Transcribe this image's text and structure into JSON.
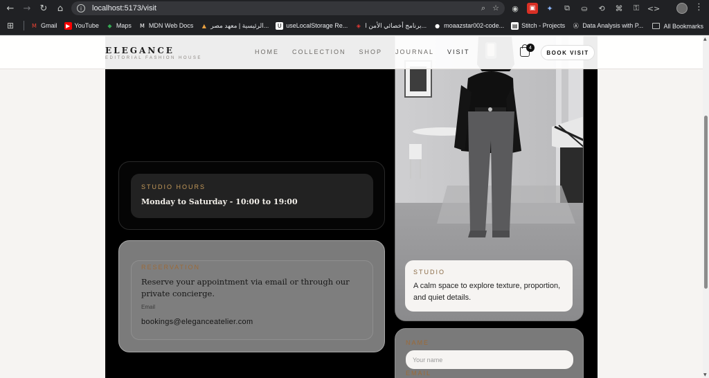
{
  "browser": {
    "url": "localhost:5173/visit",
    "bookmarks": [
      {
        "label": "Gmail",
        "icon": "gmail-icon"
      },
      {
        "label": "YouTube",
        "icon": "youtube-icon"
      },
      {
        "label": "Maps",
        "icon": "maps-icon"
      },
      {
        "label": "MDN Web Docs",
        "icon": "mdn-icon"
      },
      {
        "label": "الرئيسية | معهد مصر...",
        "icon": "institute-icon"
      },
      {
        "label": "useLocalStorage Re...",
        "icon": "use-icon"
      },
      {
        "label": "برنامج أخصائي الأمن ا...",
        "icon": "shield-icon"
      },
      {
        "label": "moaazstar002-code...",
        "icon": "github-icon"
      },
      {
        "label": "Stitch - Projects",
        "icon": "stitch-icon"
      },
      {
        "label": "Data Analysis with P...",
        "icon": "data-icon"
      }
    ],
    "all_bookmarks": "All Bookmarks"
  },
  "header": {
    "logo": "ELEGANCE",
    "tagline": "EDITORIAL FASHION HOUSE",
    "nav": [
      "HOME",
      "COLLECTION",
      "SHOP",
      "JOURNAL",
      "VISIT"
    ],
    "active_nav": "VISIT",
    "cart_count": "4",
    "book_button": "BOOK VISIT"
  },
  "hours": {
    "eyebrow": "STUDIO HOURS",
    "text": "Monday to Saturday - 10:00 to 19:00"
  },
  "reservation": {
    "eyebrow": "RESERVATION",
    "text": "Reserve your appointment via email or through our private concierge.",
    "email_label": "Email",
    "email": "bookings@eleganceatelier.com"
  },
  "studio": {
    "eyebrow": "STUDIO",
    "text": "A calm space to explore texture, proportion, and quiet details."
  },
  "form": {
    "name_label": "NAME",
    "name_placeholder": "Your name",
    "email_label": "EMAIL"
  },
  "colors": {
    "accent": "#c59a5a",
    "panel": "#000000",
    "card_grey": "#7b7b7b"
  }
}
